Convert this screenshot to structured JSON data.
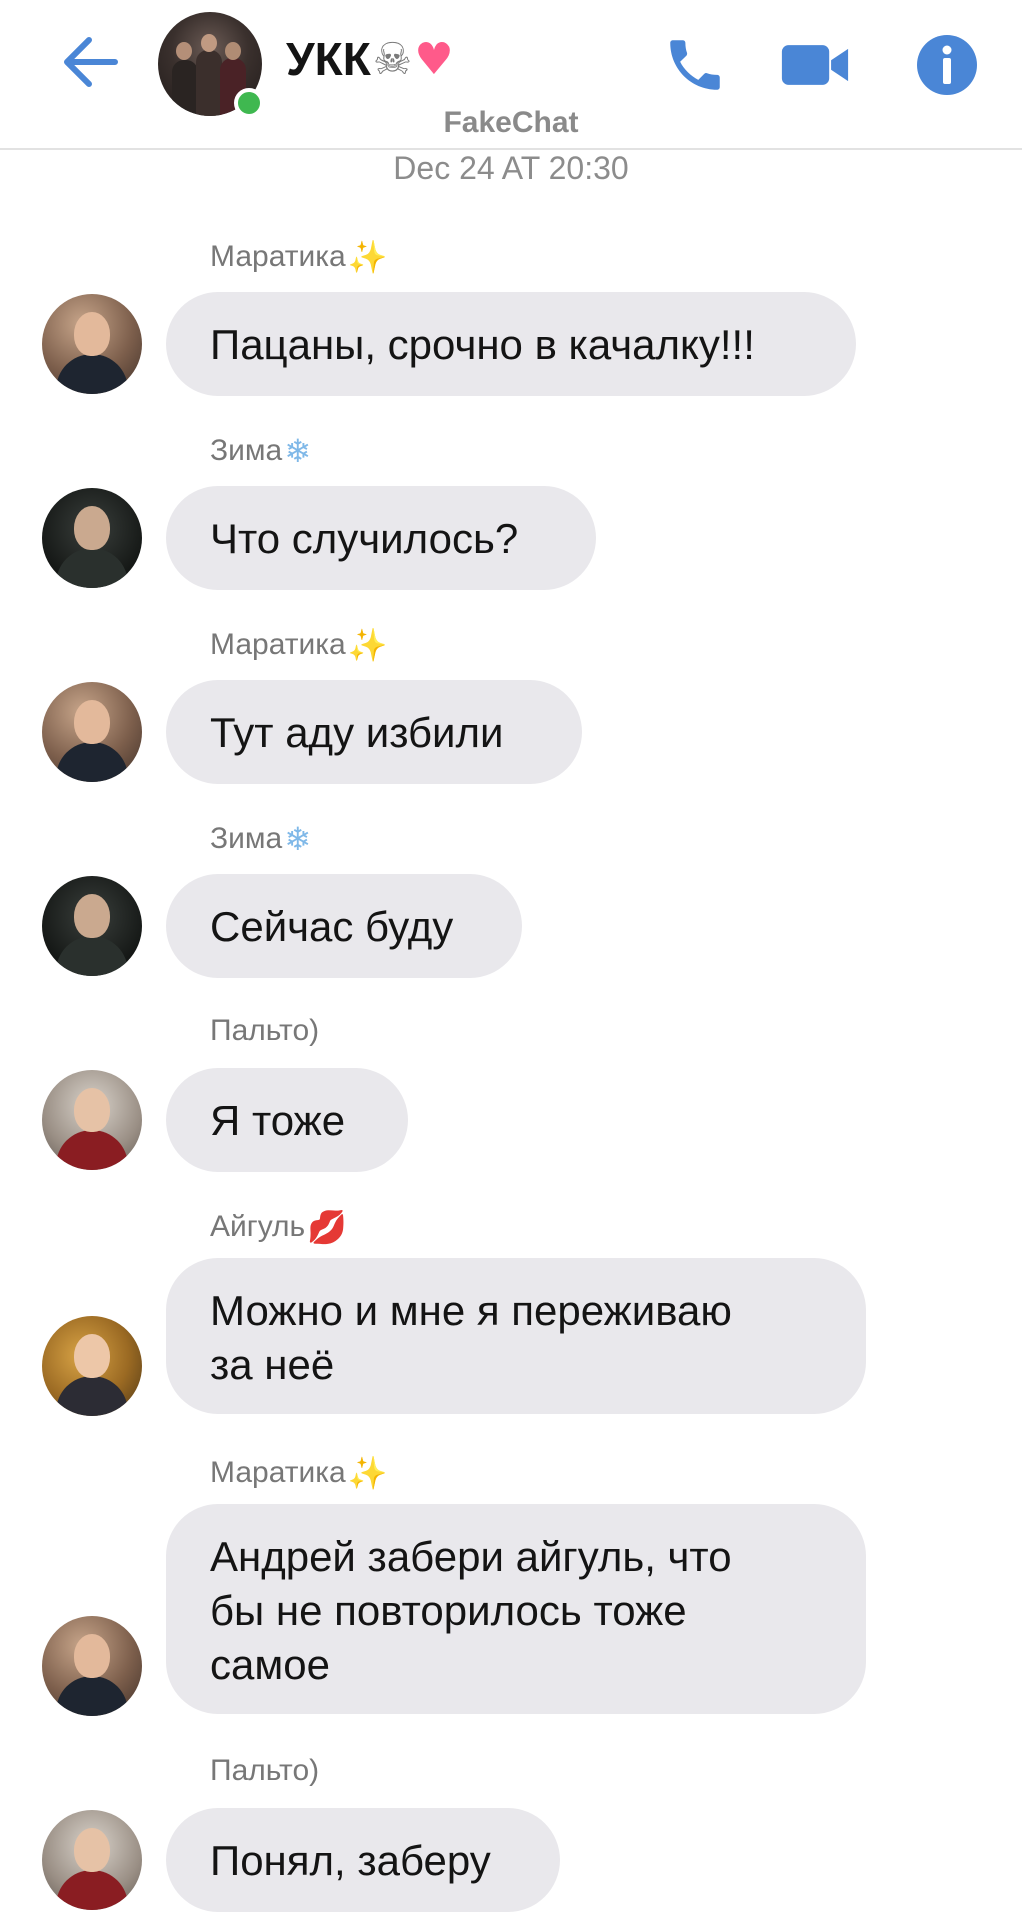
{
  "header": {
    "title": "УКК",
    "title_emojis": [
      "☠",
      "♥"
    ],
    "watermark": "FakeChat",
    "status": "online",
    "icons": {
      "back": "back-arrow-icon",
      "call": "phone-icon",
      "video": "video-camera-icon",
      "info": "info-icon"
    },
    "accent_color": "#4a86d6"
  },
  "timestamp": "Dec 24 AT 20:30",
  "messages": [
    {
      "sender": "Маратика",
      "sender_emoji": "✨",
      "text": "Пацаны, срочно в качалку!!!"
    },
    {
      "sender": "Зима",
      "sender_emoji": "❄",
      "text": "Что случилось?"
    },
    {
      "sender": "Маратика",
      "sender_emoji": "✨",
      "text": "Тут аду избили"
    },
    {
      "sender": "Зима",
      "sender_emoji": "❄",
      "text": "Сейчас буду"
    },
    {
      "sender": "Пальто)",
      "sender_emoji": "",
      "text": "Я тоже"
    },
    {
      "sender": "Айгуль",
      "sender_emoji": "💋",
      "text": "Можно и мне я переживаю\nза неё"
    },
    {
      "sender": "Маратика",
      "sender_emoji": "✨",
      "text": "Андрей забери айгуль, что\nбы не повторилось тоже\nсамое"
    },
    {
      "sender": "Пальто)",
      "sender_emoji": "",
      "text": "Понял, заберу"
    }
  ],
  "colors": {
    "bubble": "#e9e8ec",
    "online": "#3fb850",
    "icon_blue": "#4a86d6"
  }
}
